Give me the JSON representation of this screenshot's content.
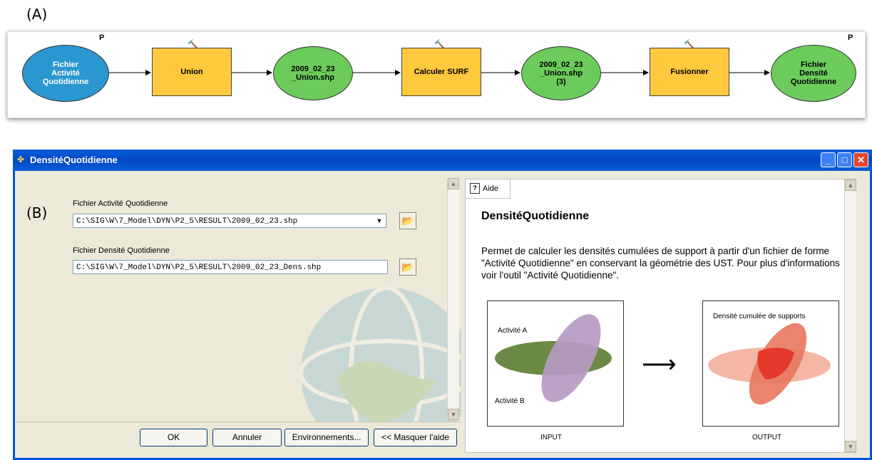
{
  "labels": {
    "a": "(A)",
    "b": "(B)"
  },
  "model": {
    "param_marker": "P",
    "nodes": {
      "input": "Fichier Activité Quotidienne",
      "union": "Union",
      "out1": "2009_02_23 _Union.shp",
      "calc": "Calculer SURF",
      "out2": "2009_02_23 _Union.shp (3)",
      "fus": "Fusionner",
      "output": "Fichier Densité Quotidienne"
    }
  },
  "dialog": {
    "title": "DensitéQuotidienne",
    "field1": {
      "label": "Fichier Activité Quotidienne",
      "value": "C:\\SIG\\W\\7_Model\\DYN\\P2_5\\RESULT\\2009_02_23.shp"
    },
    "field2": {
      "label": "Fichier Densité Quotidienne",
      "value": "C:\\SIG\\W\\7_Model\\DYN\\P2_5\\RESULT\\2009_02_23_Dens.shp"
    },
    "buttons": {
      "ok": "OK",
      "cancel": "Annuler",
      "env": "Environnements...",
      "hide": "<< Masquer l'aide"
    }
  },
  "help": {
    "tab": "Aide",
    "title": "DensitéQuotidienne",
    "body": "Permet de calculer les densités cumulées de support à partir d'un fichier de forme \"Activité Quotidienne\" en conservant la géométrie des UST. Pour plus d'informations voir l'outil \"Activité Quotidienne\".",
    "fig": {
      "activite_a": "Activité A",
      "activite_b": "Activité B",
      "densite": "Densité cumulée de supports",
      "input": "INPUT",
      "output": "OUTPUT"
    }
  },
  "colors": {
    "input_node": "#2b97d0",
    "data_node": "#6ccc5b",
    "tool_node": "#ffc83d",
    "titlebar": "#0054e3"
  }
}
